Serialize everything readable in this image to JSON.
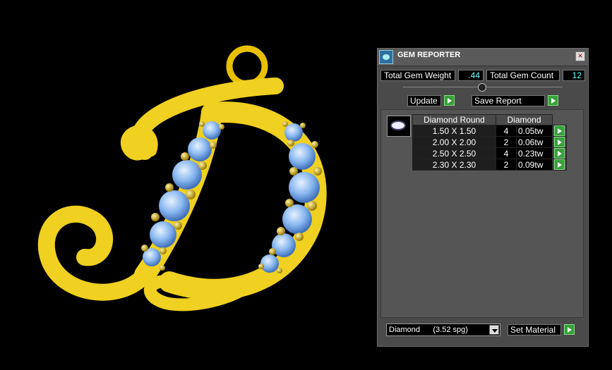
{
  "panel": {
    "title": "GEM REPORTER",
    "close_glyph": "×",
    "total_weight_label": "Total Gem Weight",
    "total_weight_value": ".44",
    "total_count_label": "Total Gem Count",
    "total_count_value": "12",
    "update_label": "Update",
    "save_report_label": "Save Report",
    "table": {
      "header_shape": "Diamond Round",
      "header_material": "Diamond",
      "rows": [
        {
          "size": "1.50 X 1.50",
          "count": "4",
          "weight": "0.05tw"
        },
        {
          "size": "2.00 X 2.00",
          "count": "2",
          "weight": "0.06tw"
        },
        {
          "size": "2.50 X 2.50",
          "count": "4",
          "weight": "0.23tw"
        },
        {
          "size": "2.30 X 2.30",
          "count": "2",
          "weight": "0.09tw"
        }
      ]
    },
    "material_select": "Diamond      (3.52 spg)",
    "set_material_label": "Set Material"
  },
  "icons": [
    "gem-reporter-app-icon",
    "close-icon",
    "play-arrow-icon",
    "gem-thumbnail-icon",
    "dropdown-arrow-icon"
  ],
  "colors": {
    "gold": "#f0d020",
    "gem_blue": "#8ab8f0",
    "value_cyan": "#66ffff",
    "go_green": "#38a038"
  }
}
